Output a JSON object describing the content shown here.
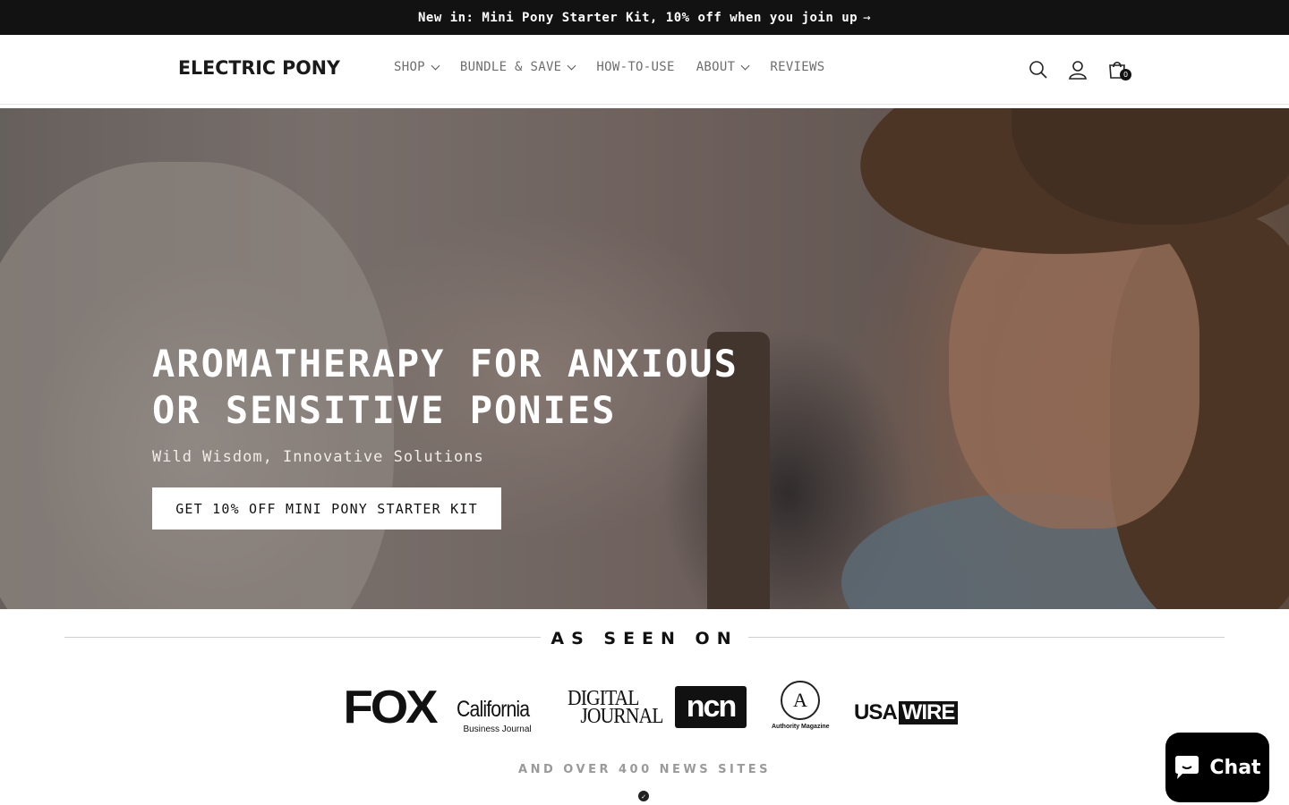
{
  "announcement": {
    "text": "New in: Mini Pony Starter Kit, 10% off when you join up",
    "arrow": "→"
  },
  "header": {
    "logo": "ELECTRIC PONY",
    "nav": [
      {
        "label": "SHOP",
        "dropdown": true
      },
      {
        "label": "BUNDLE & SAVE",
        "dropdown": true
      },
      {
        "label": "HOW-TO-USE",
        "dropdown": false
      },
      {
        "label": "ABOUT",
        "dropdown": true
      },
      {
        "label": "REVIEWS",
        "dropdown": false
      }
    ],
    "icons": [
      "search-icon",
      "account-icon",
      "cart-icon"
    ],
    "cart_count": "0"
  },
  "hero": {
    "title": "AROMATHERAPY FOR ANXIOUS OR SENSITIVE PONIES",
    "subtitle": "Wild Wisdom, Innovative Solutions",
    "cta": "GET 10% OFF MINI PONY STARTER KIT"
  },
  "press": {
    "title": "AS SEEN ON",
    "logos": {
      "fox": "FOX",
      "cbj_main": "California",
      "cbj_sub": "Business Journal",
      "dj_line1": "DIGITAL",
      "dj_line2": "JOURNAL",
      "ncn": "ncn",
      "am_mark": "A",
      "am_text": "Authority Magazine",
      "usa": "USA",
      "wire": "WIRE"
    },
    "more": "AND OVER 400 NEWS SITES"
  },
  "chat": {
    "label": "Chat"
  },
  "colors": {
    "dark": "#121212",
    "chat_bg": "#000000",
    "muted": "#9a9a9a"
  }
}
